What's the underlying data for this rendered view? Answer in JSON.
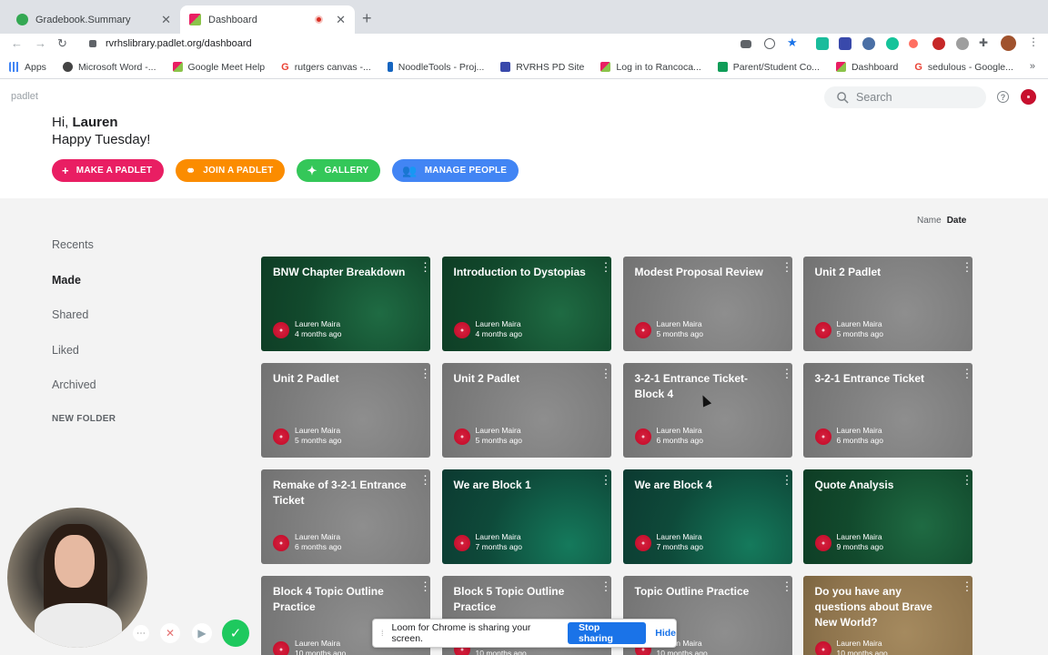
{
  "browser": {
    "tabs": [
      {
        "title": "Gradebook.Summary",
        "favicon_color": "#34a853"
      },
      {
        "title": "Dashboard",
        "favicon_color": "#8e3d8a"
      }
    ],
    "url": "rvrhslibrary.padlet.org/dashboard",
    "bookmarks": [
      {
        "label": "Apps",
        "color": "#4285f4"
      },
      {
        "label": "Microsoft Word -...",
        "color": "#444444"
      },
      {
        "label": "Google Meet Help",
        "color": "#9c27b0"
      },
      {
        "label": "rutgers canvas -...",
        "color": "#ea4335"
      },
      {
        "label": "NoodleTools - Proj...",
        "color": "#1565c0"
      },
      {
        "label": "RVRHS PD Site",
        "color": "#3949ab"
      },
      {
        "label": "Log in to Rancoca...",
        "color": "#8e3d8a"
      },
      {
        "label": "Parent/Student Co...",
        "color": "#0f9d58"
      },
      {
        "label": "Dashboard",
        "color": "#8e3d8a"
      },
      {
        "label": "sedulous - Google...",
        "color": "#ea4335"
      }
    ]
  },
  "app": {
    "logo": "padlet",
    "search_placeholder": "Search",
    "help": "?",
    "greeting_prefix": "Hi,",
    "user_name": "Lauren",
    "greeting_line2": "Happy Tuesday!",
    "actions": [
      {
        "label": "MAKE A PADLET",
        "icon": "+",
        "color": "#e91e63"
      },
      {
        "label": "JOIN A PADLET",
        "icon": "⚭",
        "color": "#fb8c00"
      },
      {
        "label": "GALLERY",
        "icon": "✦",
        "color": "#34c759"
      },
      {
        "label": "MANAGE PEOPLE",
        "icon": "👥",
        "color": "#4285f4"
      }
    ]
  },
  "sidebar": {
    "items": [
      {
        "label": "Recents",
        "active": false
      },
      {
        "label": "Made",
        "active": true
      },
      {
        "label": "Shared",
        "active": false
      },
      {
        "label": "Liked",
        "active": false
      },
      {
        "label": "Archived",
        "active": false
      }
    ],
    "new_folder": "NEW FOLDER"
  },
  "sort": {
    "name": "Name",
    "date": "Date"
  },
  "cards": [
    {
      "title": "BNW Chapter Breakdown",
      "author": "Lauren Maira",
      "time": "4 months ago",
      "theme": "green"
    },
    {
      "title": "Introduction to Dystopias",
      "author": "Lauren Maira",
      "time": "4 months ago",
      "theme": "green"
    },
    {
      "title": "Modest Proposal Review",
      "author": "Lauren Maira",
      "time": "5 months ago",
      "theme": "gray"
    },
    {
      "title": "Unit 2 Padlet",
      "author": "Lauren Maira",
      "time": "5 months ago",
      "theme": "gray"
    },
    {
      "title": "Unit 2 Padlet",
      "author": "Lauren Maira",
      "time": "5 months ago",
      "theme": "gray"
    },
    {
      "title": "Unit 2 Padlet",
      "author": "Lauren Maira",
      "time": "5 months ago",
      "theme": "gray"
    },
    {
      "title": "3-2-1 Entrance Ticket- Block 4",
      "author": "Lauren Maira",
      "time": "6 months ago",
      "theme": "gray"
    },
    {
      "title": "3-2-1 Entrance Ticket",
      "author": "Lauren Maira",
      "time": "6 months ago",
      "theme": "gray"
    },
    {
      "title": "Remake of 3-2-1 Entrance Ticket",
      "author": "Lauren Maira",
      "time": "6 months ago",
      "theme": "gray"
    },
    {
      "title": "We are Block 1",
      "author": "Lauren Maira",
      "time": "7 months ago",
      "theme": "teal"
    },
    {
      "title": "We are Block 4",
      "author": "Lauren Maira",
      "time": "7 months ago",
      "theme": "teal"
    },
    {
      "title": "Quote Analysis",
      "author": "Lauren Maira",
      "time": "9 months ago",
      "theme": "green"
    },
    {
      "title": "Block 4 Topic Outline Practice",
      "author": "Lauren Maira",
      "time": "10 months ago",
      "theme": "gray"
    },
    {
      "title": "Block 5 Topic Outline Practice",
      "author": "Lauren Maira",
      "time": "10 months ago",
      "theme": "gray"
    },
    {
      "title": "Topic Outline Practice",
      "author": "Lauren Maira",
      "time": "10 months ago",
      "theme": "gray"
    },
    {
      "title": "Do you have any questions about Brave New World?",
      "author": "Lauren Maira",
      "time": "10 months ago",
      "theme": "tan"
    }
  ],
  "loom": {
    "message": "Loom for Chrome is sharing your screen.",
    "stop_label": "Stop sharing",
    "hide_label": "Hide"
  }
}
